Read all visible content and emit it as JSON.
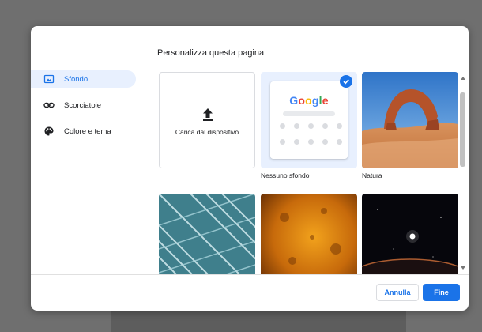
{
  "dialog": {
    "title": "Personalizza questa pagina"
  },
  "sidebar": {
    "items": [
      {
        "label": "Sfondo",
        "icon": "image-icon",
        "active": true
      },
      {
        "label": "Scorciatoie",
        "icon": "link-icon",
        "active": false
      },
      {
        "label": "Colore e tema",
        "icon": "palette-icon",
        "active": false
      }
    ]
  },
  "backgrounds": {
    "upload_label": "Carica dal dispositivo",
    "no_background_label": "Nessuno sfondo",
    "nature_label": "Natura",
    "preview_logo": "Google"
  },
  "buttons": {
    "cancel": "Annulla",
    "done": "Fine"
  },
  "colors": {
    "accent": "#1a73e8",
    "active_nav_bg": "#e8f0fe"
  }
}
